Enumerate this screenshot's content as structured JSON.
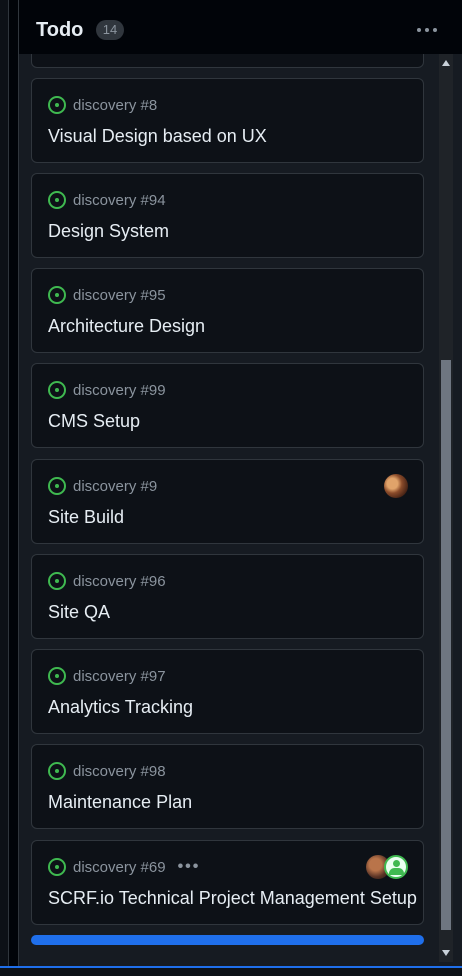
{
  "column": {
    "title": "Todo",
    "count": "14"
  },
  "cards": [
    {
      "meta": "discovery #8",
      "title": "Visual Design based on UX"
    },
    {
      "meta": "discovery #94",
      "title": "Design System"
    },
    {
      "meta": "discovery #95",
      "title": "Architecture Design"
    },
    {
      "meta": "discovery #99",
      "title": "CMS Setup"
    },
    {
      "meta": "discovery #9",
      "title": "Site Build"
    },
    {
      "meta": "discovery #96",
      "title": "Site QA"
    },
    {
      "meta": "discovery #97",
      "title": "Analytics Tracking"
    },
    {
      "meta": "discovery #98",
      "title": "Maintenance Plan"
    },
    {
      "meta": "discovery #69",
      "title": "SCRF.io Technical Project Management Setup"
    }
  ],
  "icons": {
    "status": "issue-open-icon",
    "menu": "kebab-horizontal-icon"
  },
  "colors": {
    "status_open": "#3fb950",
    "accent": "#1f6feb"
  }
}
